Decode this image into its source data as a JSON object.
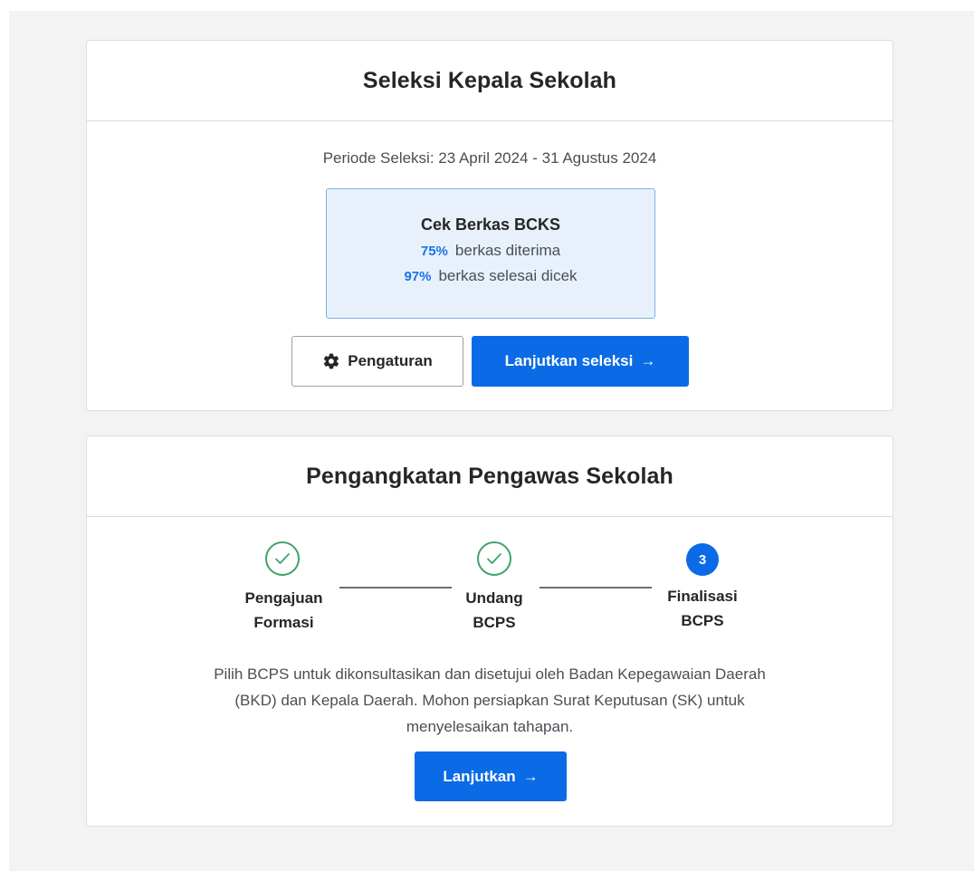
{
  "selection_card": {
    "title": "Seleksi Kepala Sekolah",
    "period": "Periode Seleksi: 23 April 2024 - 31 Agustus 2024",
    "summary": {
      "title": "Cek Berkas BCKS",
      "received_pct": "75%",
      "received_label": "berkas diterima",
      "checked_pct": "97%",
      "checked_label": "berkas selesai dicek"
    },
    "settings_label": "Pengaturan",
    "continue_label": "Lanjutkan seleksi",
    "arrow": "→"
  },
  "appointment_card": {
    "title": "Pengangkatan Pengawas Sekolah",
    "steps": [
      {
        "line1": "Pengajuan",
        "line2": "Formasi",
        "status": "done"
      },
      {
        "line1": "Undang",
        "line2": "BCPS",
        "status": "done"
      },
      {
        "line1": "Finalisasi",
        "line2": "BCPS",
        "status": "current",
        "number": "3"
      }
    ],
    "description": "Pilih BCPS untuk dikonsultasikan dan disetujui oleh Badan Kepegawaian Daerah (BKD) dan Kepala Daerah. Mohon persiapkan Surat Keputusan (SK) untuk menyelesaikan tahapan.",
    "continue_label": "Lanjutkan",
    "arrow": "→"
  },
  "colors": {
    "primary": "#0b6ae6",
    "success": "#3fa36b",
    "info_bg": "#e8f1fb",
    "info_border": "#7db0e8"
  }
}
